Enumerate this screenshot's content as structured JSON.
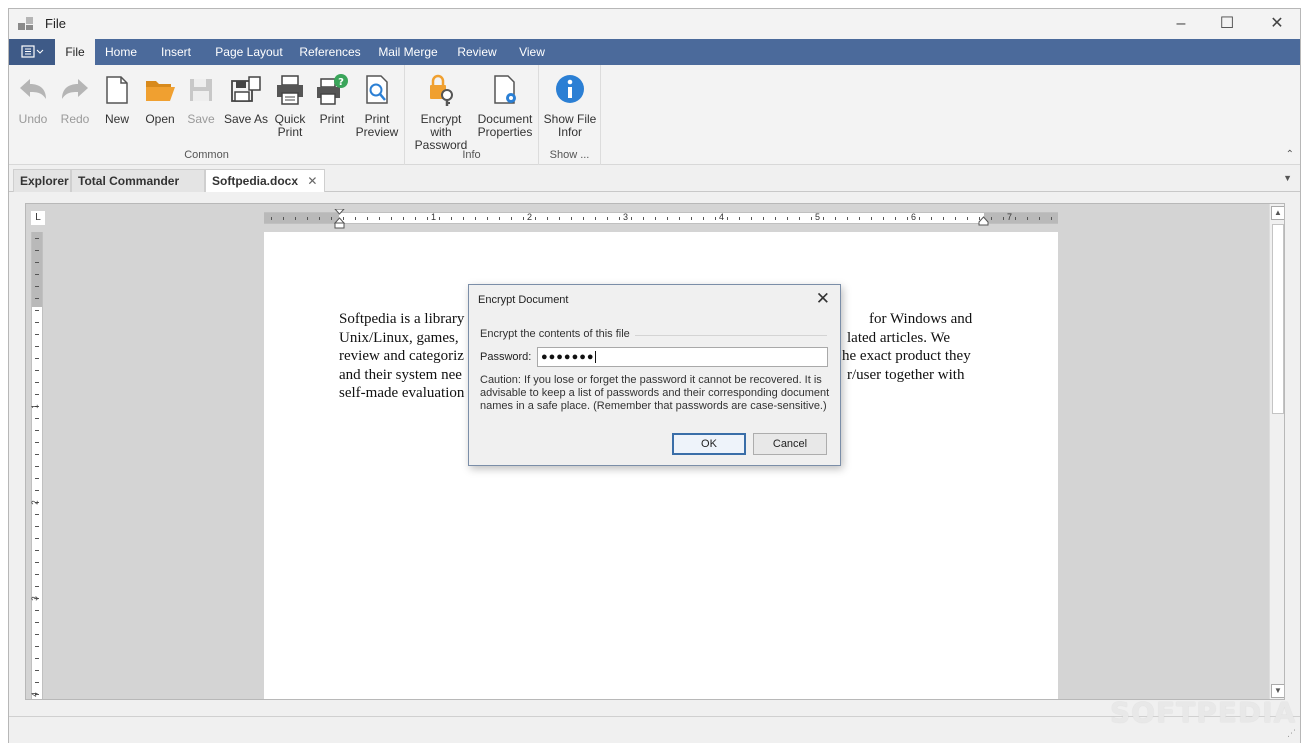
{
  "window": {
    "title": "File"
  },
  "menu": {
    "tabs": [
      {
        "label": "File"
      },
      {
        "label": "Home"
      },
      {
        "label": "Insert"
      },
      {
        "label": "Page Layout"
      },
      {
        "label": "References"
      },
      {
        "label": "Mail Merge"
      },
      {
        "label": "Review"
      },
      {
        "label": "View"
      }
    ]
  },
  "ribbon": {
    "groups": {
      "common": {
        "label": "Common",
        "buttons": [
          {
            "label": "Undo",
            "icon": "undo-icon",
            "enabled": false
          },
          {
            "label": "Redo",
            "icon": "redo-icon",
            "enabled": false
          },
          {
            "label": "New",
            "icon": "new-document-icon",
            "enabled": true
          },
          {
            "label": "Open",
            "icon": "open-folder-icon",
            "enabled": true
          },
          {
            "label": "Save",
            "icon": "save-icon",
            "enabled": false
          },
          {
            "label": "Save As",
            "icon": "save-as-icon",
            "enabled": true
          },
          {
            "label": "Quick Print",
            "icon": "quick-print-icon",
            "enabled": true
          },
          {
            "label": "Print",
            "icon": "print-icon",
            "enabled": true
          },
          {
            "label": "Print Preview",
            "icon": "print-preview-icon",
            "enabled": true
          }
        ]
      },
      "info": {
        "label": "Info",
        "buttons": [
          {
            "label": "Encrypt with Password",
            "icon": "encrypt-lock-key-icon"
          },
          {
            "label": "Document Properties",
            "icon": "document-properties-icon"
          }
        ]
      },
      "show": {
        "label": "Show ...",
        "buttons": [
          {
            "label": "Show File Infor",
            "icon": "info-icon"
          }
        ]
      }
    }
  },
  "doc_tabs": [
    {
      "label": "Explorer"
    },
    {
      "label": "Total Commander"
    },
    {
      "label": "Softpedia.docx",
      "close": "✕"
    }
  ],
  "ruler": {
    "corner": "L",
    "h_numbers": [
      "1",
      "2",
      "3",
      "4",
      "5",
      "6",
      "7"
    ],
    "v_numbers": [
      "1",
      "2",
      "3",
      "4"
    ]
  },
  "document": {
    "lines": [
      "Softpedia is a library",
      "Unix/Linux, games,",
      "review and categoriz",
      "and their system nee",
      "self-made evaluation"
    ],
    "lines_right": [
      "for Windows and",
      "lated articles. We",
      "he exact product they",
      "r/user together with",
      ""
    ]
  },
  "dialog": {
    "title": "Encrypt Document",
    "close": "✕",
    "group_label": "Encrypt the contents of this file",
    "password_label": "Password:",
    "password_value": "●●●●●●●",
    "caution": "Caution: If you lose or forget the password it cannot be recovered. It is advisable to keep a list of passwords and their corresponding document names in a safe place. (Remember that passwords are case-sensitive.)",
    "ok": "OK",
    "cancel": "Cancel"
  },
  "watermark": "SOFTPEDIA",
  "colors": {
    "menubar": "#4b6a9b",
    "accent": "#3a6ea8",
    "folder": "#f0a030",
    "info_blue": "#2b7fd4",
    "print_badge": "#3aa55a"
  }
}
